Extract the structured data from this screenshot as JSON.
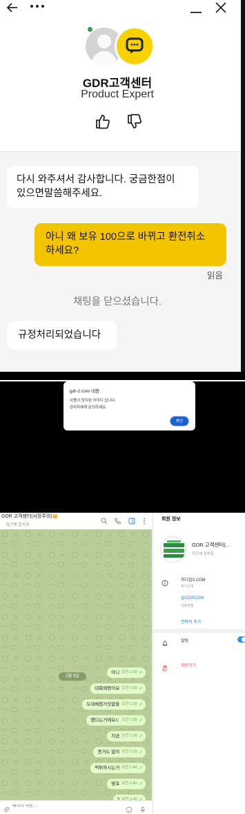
{
  "panel1": {
    "header": {
      "back_icon": "back-arrow-icon",
      "more_icon": "more-dots-icon",
      "minimize_icon": "minimize-icon",
      "close_icon": "close-icon"
    },
    "agent": {
      "name": "GDR고객센터",
      "role": "Product Expert",
      "status_color": "#2e9b5a",
      "badge_color": "#f7d200"
    },
    "messages": [
      {
        "side": "left",
        "line1": "다시 와주셔서 감사합니다. 궁금한점이",
        "line2": "있으면말씀해주세요."
      },
      {
        "side": "right",
        "line1": "아니 왜 보유 100으로 바뀌고 환전취소",
        "line2": "하세요?"
      },
      {
        "side": "left",
        "text": "규정처리되었습니다"
      }
    ],
    "read_label": "읽음",
    "closed_note": "채팅을 닫으셨습니다."
  },
  "panel2": {
    "alert": {
      "title": "gdr-2.com 내용:",
      "line1": "사용이 정지된 아이디 입니다.",
      "line2": "관리자에게 문의하세요.",
      "ok_label": "확인"
    }
  },
  "panel3": {
    "header": {
      "title": "GDR 고객센터(사장주의)👑",
      "subtitle": "최근에 접속함"
    },
    "date_pill": "2월 5일",
    "messages": [
      {
        "text": "아니",
        "time": "오전 1:39"
      },
      {
        "text": "대화왜펑어요",
        "time": "오전 1:39"
      },
      {
        "text": "도대체뭔거짓말을",
        "time": "오전 1:39"
      },
      {
        "text": "했다는거에요ㄷ",
        "time": "오전 1:39"
      },
      {
        "text": "지금",
        "time": "오전 1:39"
      },
      {
        "text": "증거도 없이",
        "time": "오전 1:39"
      },
      {
        "text": "먹튀하시는거",
        "time": "오전 1:40"
      },
      {
        "text": "맞죠",
        "time": "오전 1:40"
      },
      {
        "text": "?",
        "time": "오전 1:40"
      }
    ],
    "input_placeholder": "메시지 작성...",
    "side": {
      "title": "회원 정보",
      "name": "GDR 고객센터(...",
      "seen": "최근에 접속함",
      "site": "지디알3.COM",
      "site_label": "자기소개",
      "username": "@GDRCOM",
      "username_label": "사용자명",
      "add_contact": "연락처 추가",
      "notifications": "알림",
      "block": "차단하기"
    }
  }
}
